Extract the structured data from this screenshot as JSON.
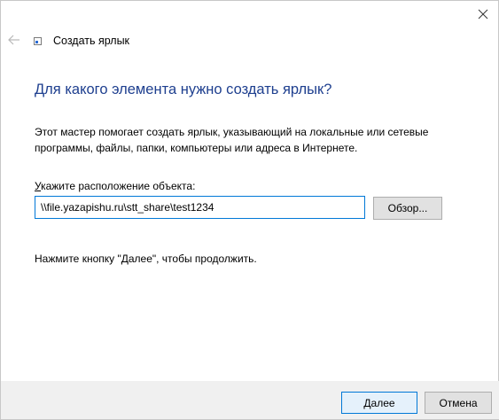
{
  "header": {
    "title": "Создать ярлык",
    "back_icon": "arrow-left-icon",
    "close_icon": "close-icon"
  },
  "main": {
    "heading": "Для какого элемента нужно создать ярлык?",
    "description": "Этот мастер помогает создать ярлык, указывающий на локальные или сетевые программы, файлы, папки, компьютеры или адреса в Интернете.",
    "location_label_first": "У",
    "location_label_rest": "кажите расположение объекта:",
    "location_value": "\\\\file.yazapishu.ru\\stt_share\\test1234",
    "browse_label": "Обзор...",
    "hint": "Нажмите кнопку \"Далее\", чтобы продолжить."
  },
  "footer": {
    "next_label": "Далее",
    "cancel_label": "Отмена"
  },
  "colors": {
    "heading": "#1e3f8f",
    "focus_border": "#0078d7",
    "footer_bg": "#f0f0f0"
  }
}
